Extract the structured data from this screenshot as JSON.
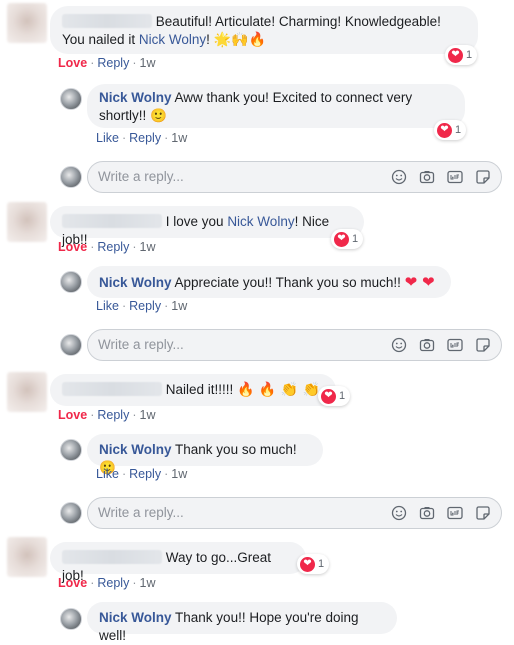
{
  "reaction_count": "1",
  "actions": {
    "love": "Love",
    "reply": "Reply",
    "like": "Like",
    "sep": "·"
  },
  "reply_box": {
    "placeholder": "Write a reply..."
  },
  "colors": {
    "love": "#f0284a",
    "link": "#385898",
    "bubble": "#f2f3f5"
  },
  "threads": [
    {
      "comment": {
        "text": " Beautiful! Articulate! Charming! Knowledgeable! You nailed it ",
        "mention": "Nick Wolny",
        "trail": "!",
        "emojis": "🌟🙌🔥",
        "timestamp": "1w"
      },
      "reply": {
        "author": "Nick Wolny",
        "text": " Aww thank you! Excited to connect very shortly!! 🙂",
        "timestamp": "1w"
      }
    },
    {
      "comment": {
        "text": "I love you ",
        "mention": "Nick Wolny",
        "trail": "! Nice job!!",
        "timestamp": "1w"
      },
      "reply": {
        "author": "Nick Wolny",
        "text": " Appreciate you!! Thank you so much!! ",
        "hearts": "❤ ❤",
        "timestamp": "1w"
      }
    },
    {
      "comment": {
        "text": "Nailed it!!!!! ",
        "emojis": "🔥 🔥 👏 👏",
        "timestamp": "1w"
      },
      "reply": {
        "author": "Nick Wolny",
        "text": " Thank you so much! 🙂",
        "timestamp": "1w"
      }
    },
    {
      "comment": {
        "text": "Way to go...Great job!",
        "timestamp": "1w"
      },
      "reply": {
        "author": "Nick Wolny",
        "text": " Thank you!! Hope you're doing well!"
      }
    }
  ]
}
